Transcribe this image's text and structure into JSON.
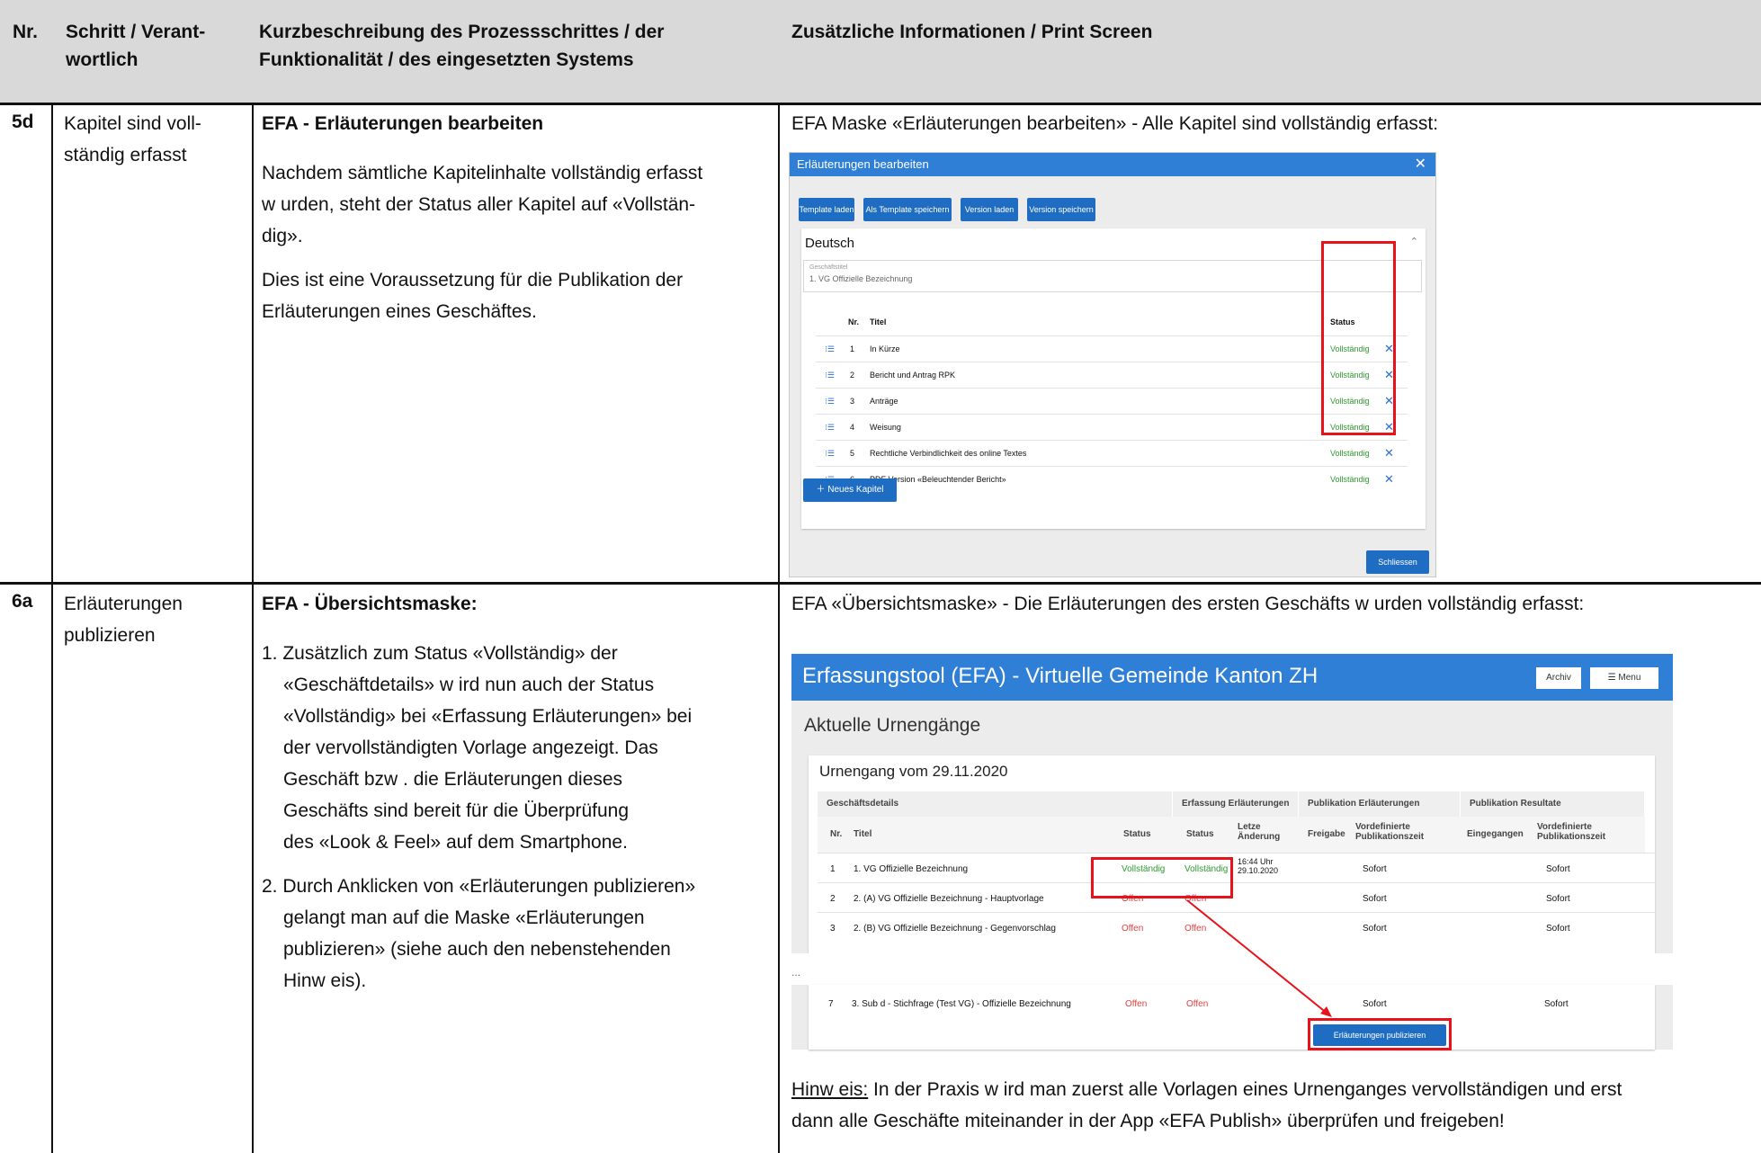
{
  "header": {
    "nr": "Nr.",
    "schritt": [
      "Schritt / Verant-",
      "wortlich"
    ],
    "kurz": [
      "Kurzbeschreibung des Prozessschrittes / der",
      "Funktionalität / des eingesetzten Systems"
    ],
    "info": "Zusätzliche Informationen / Print Screen"
  },
  "row1": {
    "nr": "5d",
    "schritt": [
      "Kapitel sind voll-",
      "ständig erfasst"
    ],
    "title": "EFA - Erläuterungen bearbeiten",
    "para1": [
      "Nachdem sämtliche Kapitelinhalte vollständig erfasst",
      "w urden, steht der Status aller Kapitel auf «Vollstän-",
      "dig»."
    ],
    "para2": [
      "Dies ist eine Voraussetzung für die Publikation der",
      "Erläuterungen eines Geschäftes."
    ],
    "info_text": "EFA Maske «Erläuterungen bearbeiten» - Alle Kapitel sind vollständig erfasst:",
    "dialog": {
      "title": "Erläuterungen bearbeiten",
      "buttons": [
        "Template laden",
        "Als Template speichern",
        "Version laden",
        "Version speichern"
      ],
      "section": "Deutsch",
      "field_label": "Geschäftstitel",
      "field_value": "1. VG Offizielle Bezeichnung",
      "col_nr": "Nr.",
      "col_titel": "Titel",
      "col_status": "Status",
      "rows": [
        {
          "nr": "1",
          "titel": "In Kürze",
          "status": "Vollständig"
        },
        {
          "nr": "2",
          "titel": "Bericht und Antrag RPK",
          "status": "Vollständig"
        },
        {
          "nr": "3",
          "titel": "Anträge",
          "status": "Vollständig"
        },
        {
          "nr": "4",
          "titel": "Weisung",
          "status": "Vollständig"
        },
        {
          "nr": "5",
          "titel": "Rechtliche Verbindlichkeit des online Textes",
          "status": "Vollständig"
        },
        {
          "nr": "6",
          "titel": "PDF Version «Beleuchtender Bericht»",
          "status": "Vollständig"
        }
      ],
      "new_chapter": "Neues Kapitel",
      "close": "Schliessen"
    }
  },
  "row2": {
    "nr": "6a",
    "schritt": [
      "Erläuterungen",
      "publizieren"
    ],
    "title": "EFA - Übersichtsmaske:",
    "list1": [
      "1. Zusätzlich zum Status «Vollständig» der",
      "«Geschäftdetails» w ird nun auch der Status",
      "«Vollständig» bei «Erfassung Erläuterungen» bei",
      "der vervollständigten Vorlage angezeigt. Das",
      "Geschäft bzw . die Erläuterungen dieses",
      "Geschäfts sind bereit für die Überprüfung",
      "des «Look & Feel» auf dem Smartphone."
    ],
    "list2": [
      "2. Durch Anklicken von «Erläuterungen publizieren»",
      "gelangt man auf die Maske «Erläuterungen",
      "publizieren» (siehe auch den nebenstehenden",
      "Hinw eis)."
    ],
    "info_text": "EFA «Übersichtsmaske» - Die Erläuterungen des ersten Geschäfts w urden vollständig erfasst:",
    "app": {
      "title": "Erfassungstool (EFA) - Virtuelle Gemeinde Kanton ZH",
      "archiv": "Archiv",
      "menu": "Menu",
      "page_title": "Aktuelle Urnengänge",
      "card_title": "Urnengang vom 29.11.2020",
      "groups": [
        "Geschäftsdetails",
        "Erfassung Erläuterungen",
        "Publikation Erläuterungen",
        "Publikation Resultate"
      ],
      "cols": [
        "Nr.",
        "Titel",
        "Status",
        "Status",
        "Letze Änderung",
        "Freigabe",
        "Vordefinierte Publikationszeit",
        "Eingegangen",
        "Vordefinierte Publikationszeit"
      ],
      "rows": [
        {
          "nr": "1",
          "titel": "1. VG Offizielle Bezeichnung",
          "s1": "Vollständig",
          "s2": "Vollständig",
          "change": "16:44 Uhr 29.10.2020",
          "pub": "Sofort",
          "res": "Sofort"
        },
        {
          "nr": "2",
          "titel": "2. (A) VG Offizielle Bezeichnung - Hauptvorlage",
          "s1": "Offen",
          "s2": "Offen",
          "change": "",
          "pub": "Sofort",
          "res": "Sofort"
        },
        {
          "nr": "3",
          "titel": "2. (B) VG Offizielle Bezeichnung - Gegenvorschlag",
          "s1": "Offen",
          "s2": "Offen",
          "change": "",
          "pub": "Sofort",
          "res": "Sofort"
        },
        {
          "nr": "7",
          "titel": "3. Sub d - Stichfrage (Test VG) - Offizielle Bezeichnung",
          "s1": "Offen",
          "s2": "Offen",
          "change": "",
          "pub": "Sofort",
          "res": "Sofort"
        }
      ],
      "ellipsis": "...",
      "publish_button": "Erläuterungen publizieren"
    },
    "note_label": "Hinw eis:",
    "note_line1": " In der Praxis w ird man zuerst alle Vorlagen eines Urnenganges vervollständigen und erst",
    "note_line2": "dann alle Geschäfte miteinander in der App «EFA Publish» überprüfen und freigeben!"
  },
  "colors": {
    "header_bg": "#d9d9d9",
    "efa_blue": "#2f7fd7",
    "highlight_red": "#e8121a",
    "status_green": "#2e9b2e",
    "status_red": "#e04040"
  }
}
